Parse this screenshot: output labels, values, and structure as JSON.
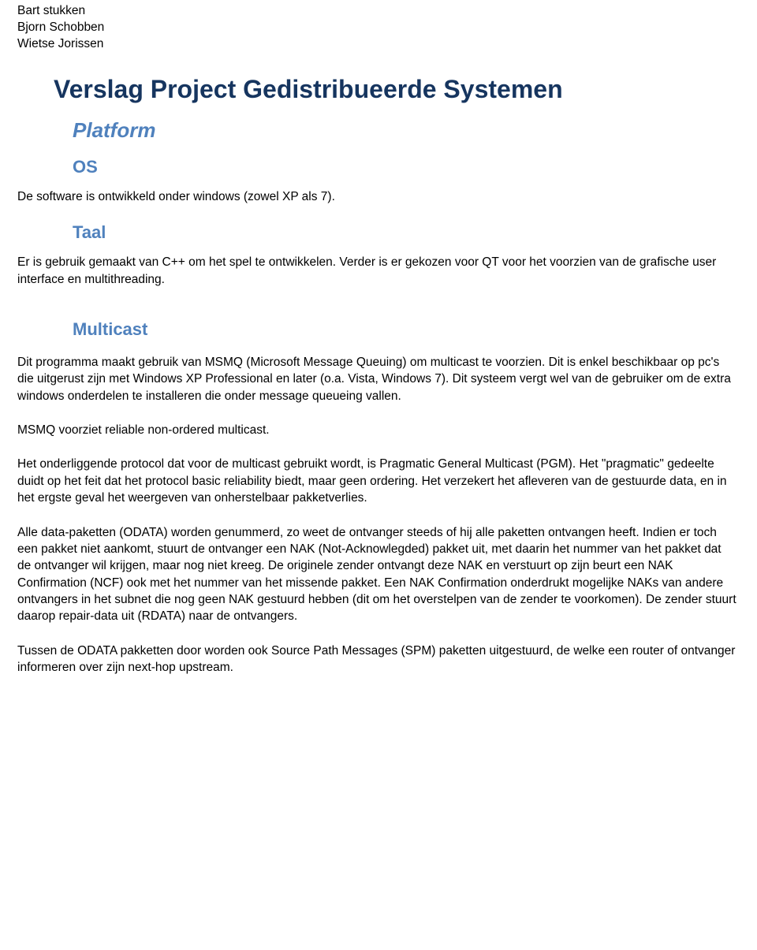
{
  "authors": [
    "Bart stukken",
    "Bjorn Schobben",
    "Wietse Jorissen"
  ],
  "title": "Verslag Project Gedistribueerde Systemen",
  "platform_heading": "Platform",
  "os_heading": "OS",
  "os_text": "De software is ontwikkeld onder windows (zowel XP als 7).",
  "taal_heading": "Taal",
  "taal_text": "Er is gebruik gemaakt van C++ om het spel te ontwikkelen. Verder is er gekozen voor QT voor het voorzien van de grafische user interface en multithreading.",
  "multicast_heading": "Multicast",
  "multicast_p1": "Dit programma maakt gebruik van MSMQ (Microsoft Message Queuing) om multicast te voorzien. Dit is enkel beschikbaar op pc's die uitgerust zijn met Windows XP Professional en later (o.a. Vista, Windows 7). Dit systeem vergt wel van de gebruiker om de extra windows onderdelen te installeren die onder message queueing vallen.",
  "multicast_p2": "MSMQ voorziet reliable non-ordered multicast.",
  "multicast_p3": "Het onderliggende protocol dat voor de multicast gebruikt wordt, is Pragmatic General Multicast (PGM). Het \"pragmatic\" gedeelte duidt op het feit dat het protocol basic reliability biedt, maar geen ordering. Het verzekert het afleveren van de gestuurde data, en in het ergste geval het weergeven van onherstelbaar pakketverlies.",
  "multicast_p4": "Alle data-paketten (ODATA) worden genummerd, zo weet de ontvanger steeds of hij alle paketten ontvangen heeft. Indien er toch een pakket niet aankomt, stuurt de ontvanger een NAK (Not-Acknowlegded) pakket uit, met daarin het nummer van het pakket dat de ontvanger wil krijgen, maar nog niet kreeg. De originele zender ontvangt deze NAK en verstuurt op zijn beurt een NAK Confirmation (NCF) ook met het nummer van het missende pakket. Een NAK Confirmation onderdrukt mogelijke NAKs van andere ontvangers in het subnet die nog geen NAK gestuurd hebben (dit om het overstelpen van de zender te voorkomen). De zender stuurt daarop repair-data uit (RDATA) naar de ontvangers.",
  "multicast_p5": "Tussen de ODATA pakketten door worden ook Source Path Messages (SPM) paketten uitgestuurd, de welke een router of ontvanger informeren over zijn next-hop upstream."
}
